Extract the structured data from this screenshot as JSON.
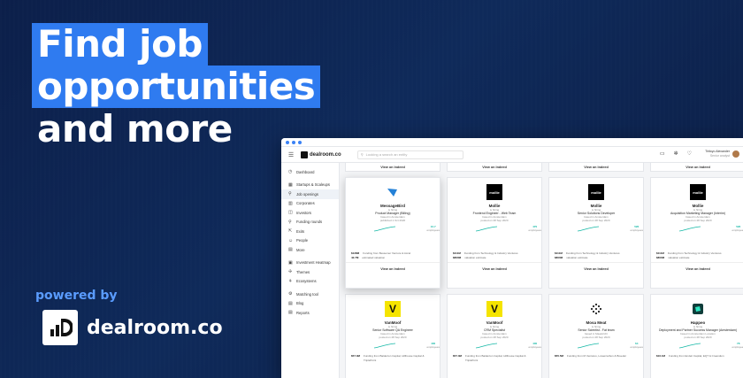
{
  "hero": {
    "line1": "Find job",
    "line2": "opportunities",
    "line3": "and more"
  },
  "powered": "powered by",
  "brand": {
    "name": "dealroom.co"
  },
  "app": {
    "logo_text": "dealroom.co",
    "search_placeholder": "Looking a search an entity",
    "user": {
      "name": "Tiritoyo Alexander",
      "role": "Senior analyst"
    },
    "sidebar": [
      {
        "label": "Dashboard",
        "icon": "◷"
      },
      {
        "label": "Startups & Scaleups",
        "icon": "▦"
      },
      {
        "label": "Job openings",
        "icon": "⚲",
        "active": true
      },
      {
        "label": "Corporates",
        "icon": "▥"
      },
      {
        "label": "Investors",
        "icon": "◫"
      },
      {
        "label": "Funding rounds",
        "icon": "⚲"
      },
      {
        "label": "Exits",
        "icon": "⇱"
      },
      {
        "label": "People",
        "icon": "☺"
      },
      {
        "label": "More",
        "icon": "▤"
      },
      {
        "label": "Investment Heatmap",
        "icon": "▣"
      },
      {
        "label": "Themes",
        "icon": "✢"
      },
      {
        "label": "Ecosystems",
        "icon": "⚘"
      },
      {
        "label": "Matching tool",
        "icon": "⚙"
      },
      {
        "label": "Blog",
        "icon": "▤"
      },
      {
        "label": "Reports",
        "icon": "▤"
      }
    ],
    "view_label": "View on Indeed",
    "cards": [
      {
        "name": "MessageBird",
        "hiring": "is hiring",
        "role": "Product Manager (Billing)",
        "loc": "based in Amsterdam",
        "posted": "published 1 Oct 2020",
        "growth": "10.7",
        "glabel": "employees",
        "funding": "$128M",
        "fund_desc": "Funding from Bessemer Venture & Accel",
        "emp": "42.7M",
        "emp_desc": "estimated valuation",
        "logo": "bird",
        "sel": true
      },
      {
        "name": "Mollie",
        "hiring": "is hiring",
        "role": "Frontend Engineer - Web Team",
        "loc": "based in Amsterdam",
        "posted": "posted on 28 Sep 2020",
        "growth": "470",
        "glabel": "employees",
        "funding": "$111M",
        "fund_desc": "Funding from Technology & Industry Ventures",
        "emp": "$800M",
        "emp_desc": "valuation estimate",
        "logo": "mollie"
      },
      {
        "name": "Mollie",
        "hiring": "is hiring",
        "role": "Senior Solutions Developer",
        "loc": "based in Amsterdam",
        "posted": "posted on 28 Sep 2020",
        "growth": "526",
        "glabel": "employees",
        "funding": "$111M",
        "fund_desc": "Funding from Technology & Industry Ventures",
        "emp": "$800M",
        "emp_desc": "valuation estimate",
        "logo": "mollie"
      },
      {
        "name": "Mollie",
        "hiring": "is hiring",
        "role": "Acquisition Marketing Manager (Interim)",
        "loc": "based in Amsterdam",
        "posted": "posted on 28 Sep 2020",
        "growth": "526",
        "glabel": "employees",
        "funding": "$111M",
        "fund_desc": "Funding from Technology & Industry Ventures",
        "emp": "$800M",
        "emp_desc": "valuation estimate",
        "logo": "mollie"
      },
      {
        "name": "VanMoof",
        "hiring": "is hiring",
        "role": "Senior Software QA Engineer",
        "loc": "based in Amsterdam",
        "posted": "posted on 28 Sep 2020",
        "growth": "400",
        "glabel": "employees",
        "funding": "$57.3M",
        "fund_desc": "Funding from Balderton Capital, Hillhouse Capital & TriplePoint",
        "logo": "vanmoof"
      },
      {
        "name": "VanMoof",
        "hiring": "is hiring",
        "role": "CRM Specialist",
        "loc": "based in Amsterdam",
        "posted": "posted on 28 Sep 2020",
        "growth": "400",
        "glabel": "employees",
        "funding": "$57.3M",
        "fund_desc": "Funding from Balderton Capital, Hillhouse Capital & TriplePoint",
        "logo": "vanmoof"
      },
      {
        "name": "Mosa Meat",
        "hiring": "is hiring",
        "role": "Senior Scientist - Fat team",
        "loc": "based in Maastricht",
        "posted": "posted on 28 Sep 2020",
        "growth": "64",
        "glabel": "employees",
        "funding": "$55.5M",
        "fund_desc": "Funding from M Ventures, Lowercarbon & Breeder",
        "logo": "mosa"
      },
      {
        "name": "Happeo",
        "hiring": "is hiring",
        "role": "Deployment and Partner Success Manager (Amsterdam)",
        "loc": "based in Amsterdam Location",
        "posted": "posted on 28 Sep 2020",
        "growth": "78",
        "glabel": "employees",
        "funding": "$16.1M",
        "fund_desc": "Funding from Endeit Capital, EQT & Creandum",
        "logo": "happeo"
      }
    ]
  },
  "colors": {
    "accent": "#2f7bf0",
    "bg": "#0f2a5a",
    "spark": "#14b8a6"
  }
}
